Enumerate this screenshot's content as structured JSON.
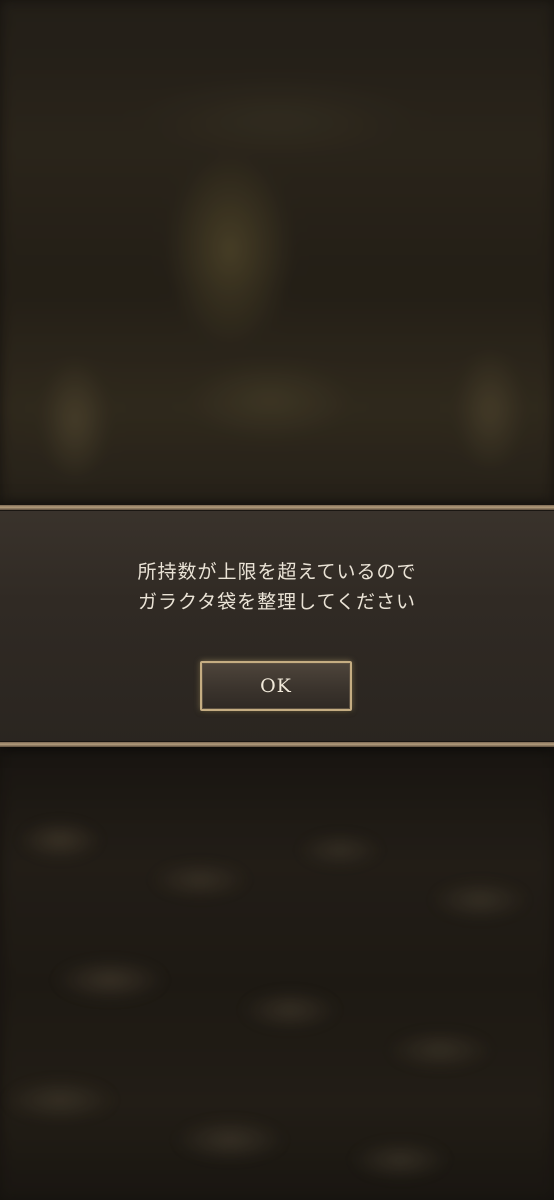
{
  "dialog": {
    "message_lines": [
      "所持数が上限を超えているので",
      "ガラクタ袋を整理してください"
    ],
    "ok_label": "OK"
  },
  "colors": {
    "dialog_background": "#302a24",
    "dialog_border": "#b39c7c",
    "button_border": "#c5ad82",
    "text": "#eae3d6"
  }
}
